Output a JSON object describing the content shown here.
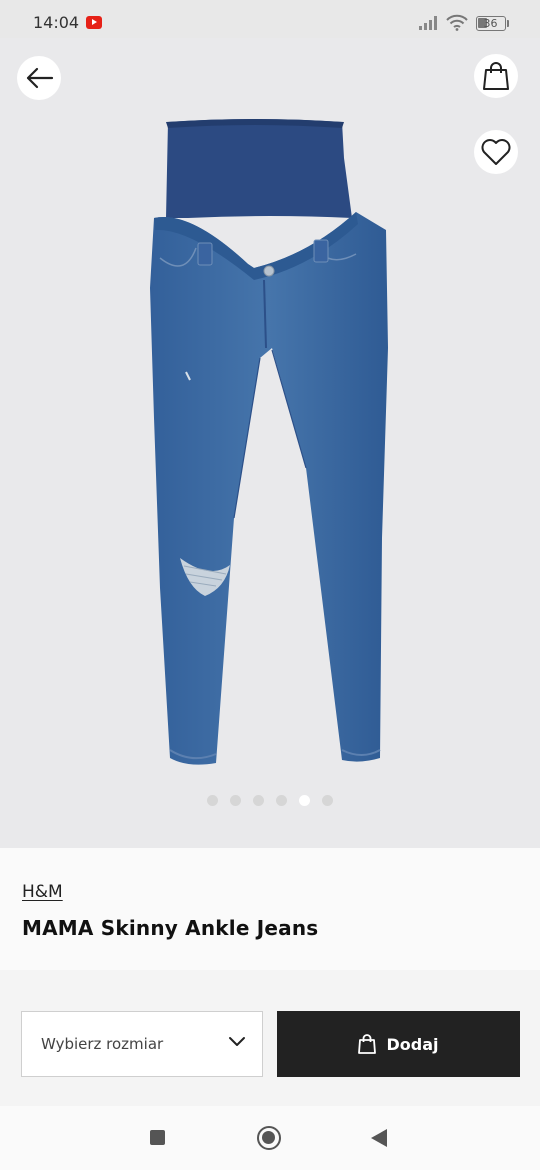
{
  "status_bar": {
    "time": "14:04",
    "battery": "36",
    "icons": [
      "youtube-notification-icon",
      "signal-icon",
      "wifi-icon",
      "battery-icon"
    ]
  },
  "header": {
    "back_icon": "arrow-left-icon",
    "bag_icon": "shopping-bag-icon",
    "favorite_icon": "heart-icon"
  },
  "gallery": {
    "image": "maternity-skinny-jeans-photo",
    "dots": [
      {
        "active": false
      },
      {
        "active": false
      },
      {
        "active": false
      },
      {
        "active": false
      },
      {
        "active": true
      },
      {
        "active": false
      }
    ]
  },
  "product": {
    "brand": "H&M",
    "title": "MAMA Skinny Ankle Jeans"
  },
  "actions": {
    "size_placeholder": "Wybierz rozmiar",
    "add_label": "Dodaj"
  },
  "colors": {
    "hero_background": "#e9e9eb",
    "button_dark": "#222222",
    "denim": "#3c6aa0",
    "waistband": "#2c4a82"
  }
}
